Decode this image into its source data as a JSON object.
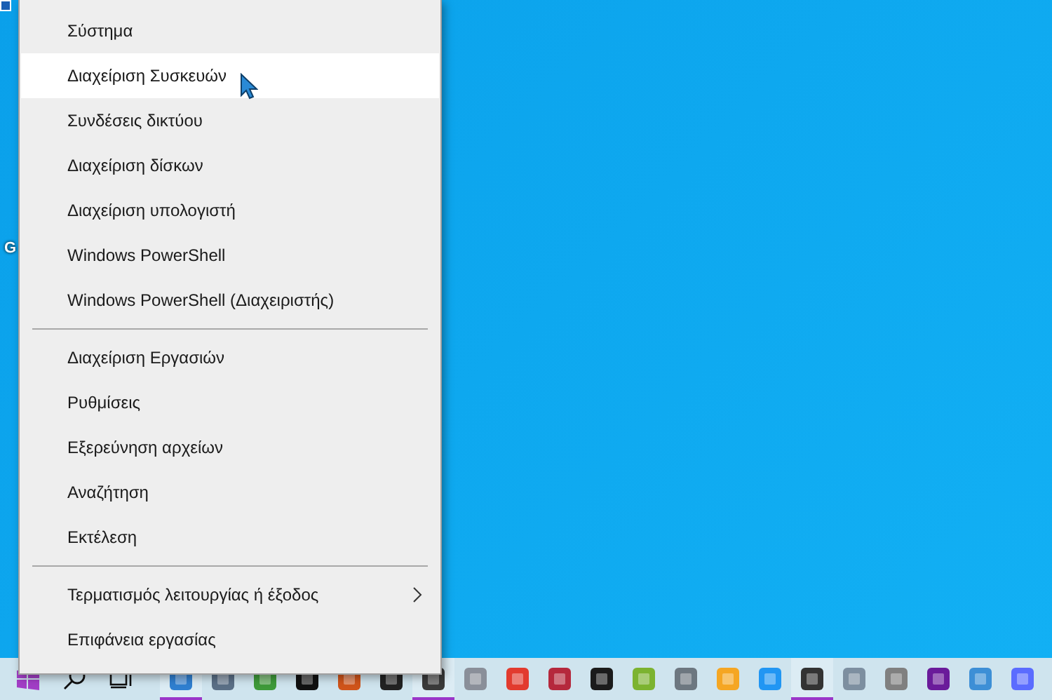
{
  "desktop": {
    "icon_label": "G"
  },
  "menu": {
    "sections": [
      {
        "items": [
          {
            "label": "Σύστημα",
            "selected": false,
            "submenu": false
          },
          {
            "label": "Διαχείριση Συσκευών",
            "selected": true,
            "submenu": false
          },
          {
            "label": "Συνδέσεις δικτύου",
            "selected": false,
            "submenu": false
          },
          {
            "label": "Διαχείριση δίσκων",
            "selected": false,
            "submenu": false
          },
          {
            "label": "Διαχείριση υπολογιστή",
            "selected": false,
            "submenu": false
          },
          {
            "label": "Windows PowerShell",
            "selected": false,
            "submenu": false
          },
          {
            "label": "Windows PowerShell (Διαχειριστής)",
            "selected": false,
            "submenu": false
          }
        ]
      },
      {
        "items": [
          {
            "label": "Διαχείριση Εργασιών",
            "selected": false,
            "submenu": false
          },
          {
            "label": "Ρυθμίσεις",
            "selected": false,
            "submenu": false
          },
          {
            "label": "Εξερεύνηση αρχείων",
            "selected": false,
            "submenu": false
          },
          {
            "label": "Αναζήτηση",
            "selected": false,
            "submenu": false
          },
          {
            "label": "Εκτέλεση",
            "selected": false,
            "submenu": false
          }
        ]
      },
      {
        "items": [
          {
            "label": "Τερματισμός λειτουργίας ή έξοδος",
            "selected": false,
            "submenu": true
          },
          {
            "label": "Επιφάνεια εργασίας",
            "selected": false,
            "submenu": false
          }
        ]
      }
    ]
  },
  "taskbar": {
    "apps": [
      {
        "running": true
      },
      {
        "running": false
      },
      {
        "running": false
      },
      {
        "running": false
      },
      {
        "running": false
      },
      {
        "running": false
      },
      {
        "running": true
      },
      {
        "running": false
      },
      {
        "running": false
      },
      {
        "running": false
      },
      {
        "running": false
      },
      {
        "running": false
      },
      {
        "running": false
      },
      {
        "running": false
      },
      {
        "running": false
      },
      {
        "running": true
      },
      {
        "running": false
      },
      {
        "running": false
      },
      {
        "running": false
      },
      {
        "running": false
      },
      {
        "running": false
      }
    ]
  }
}
